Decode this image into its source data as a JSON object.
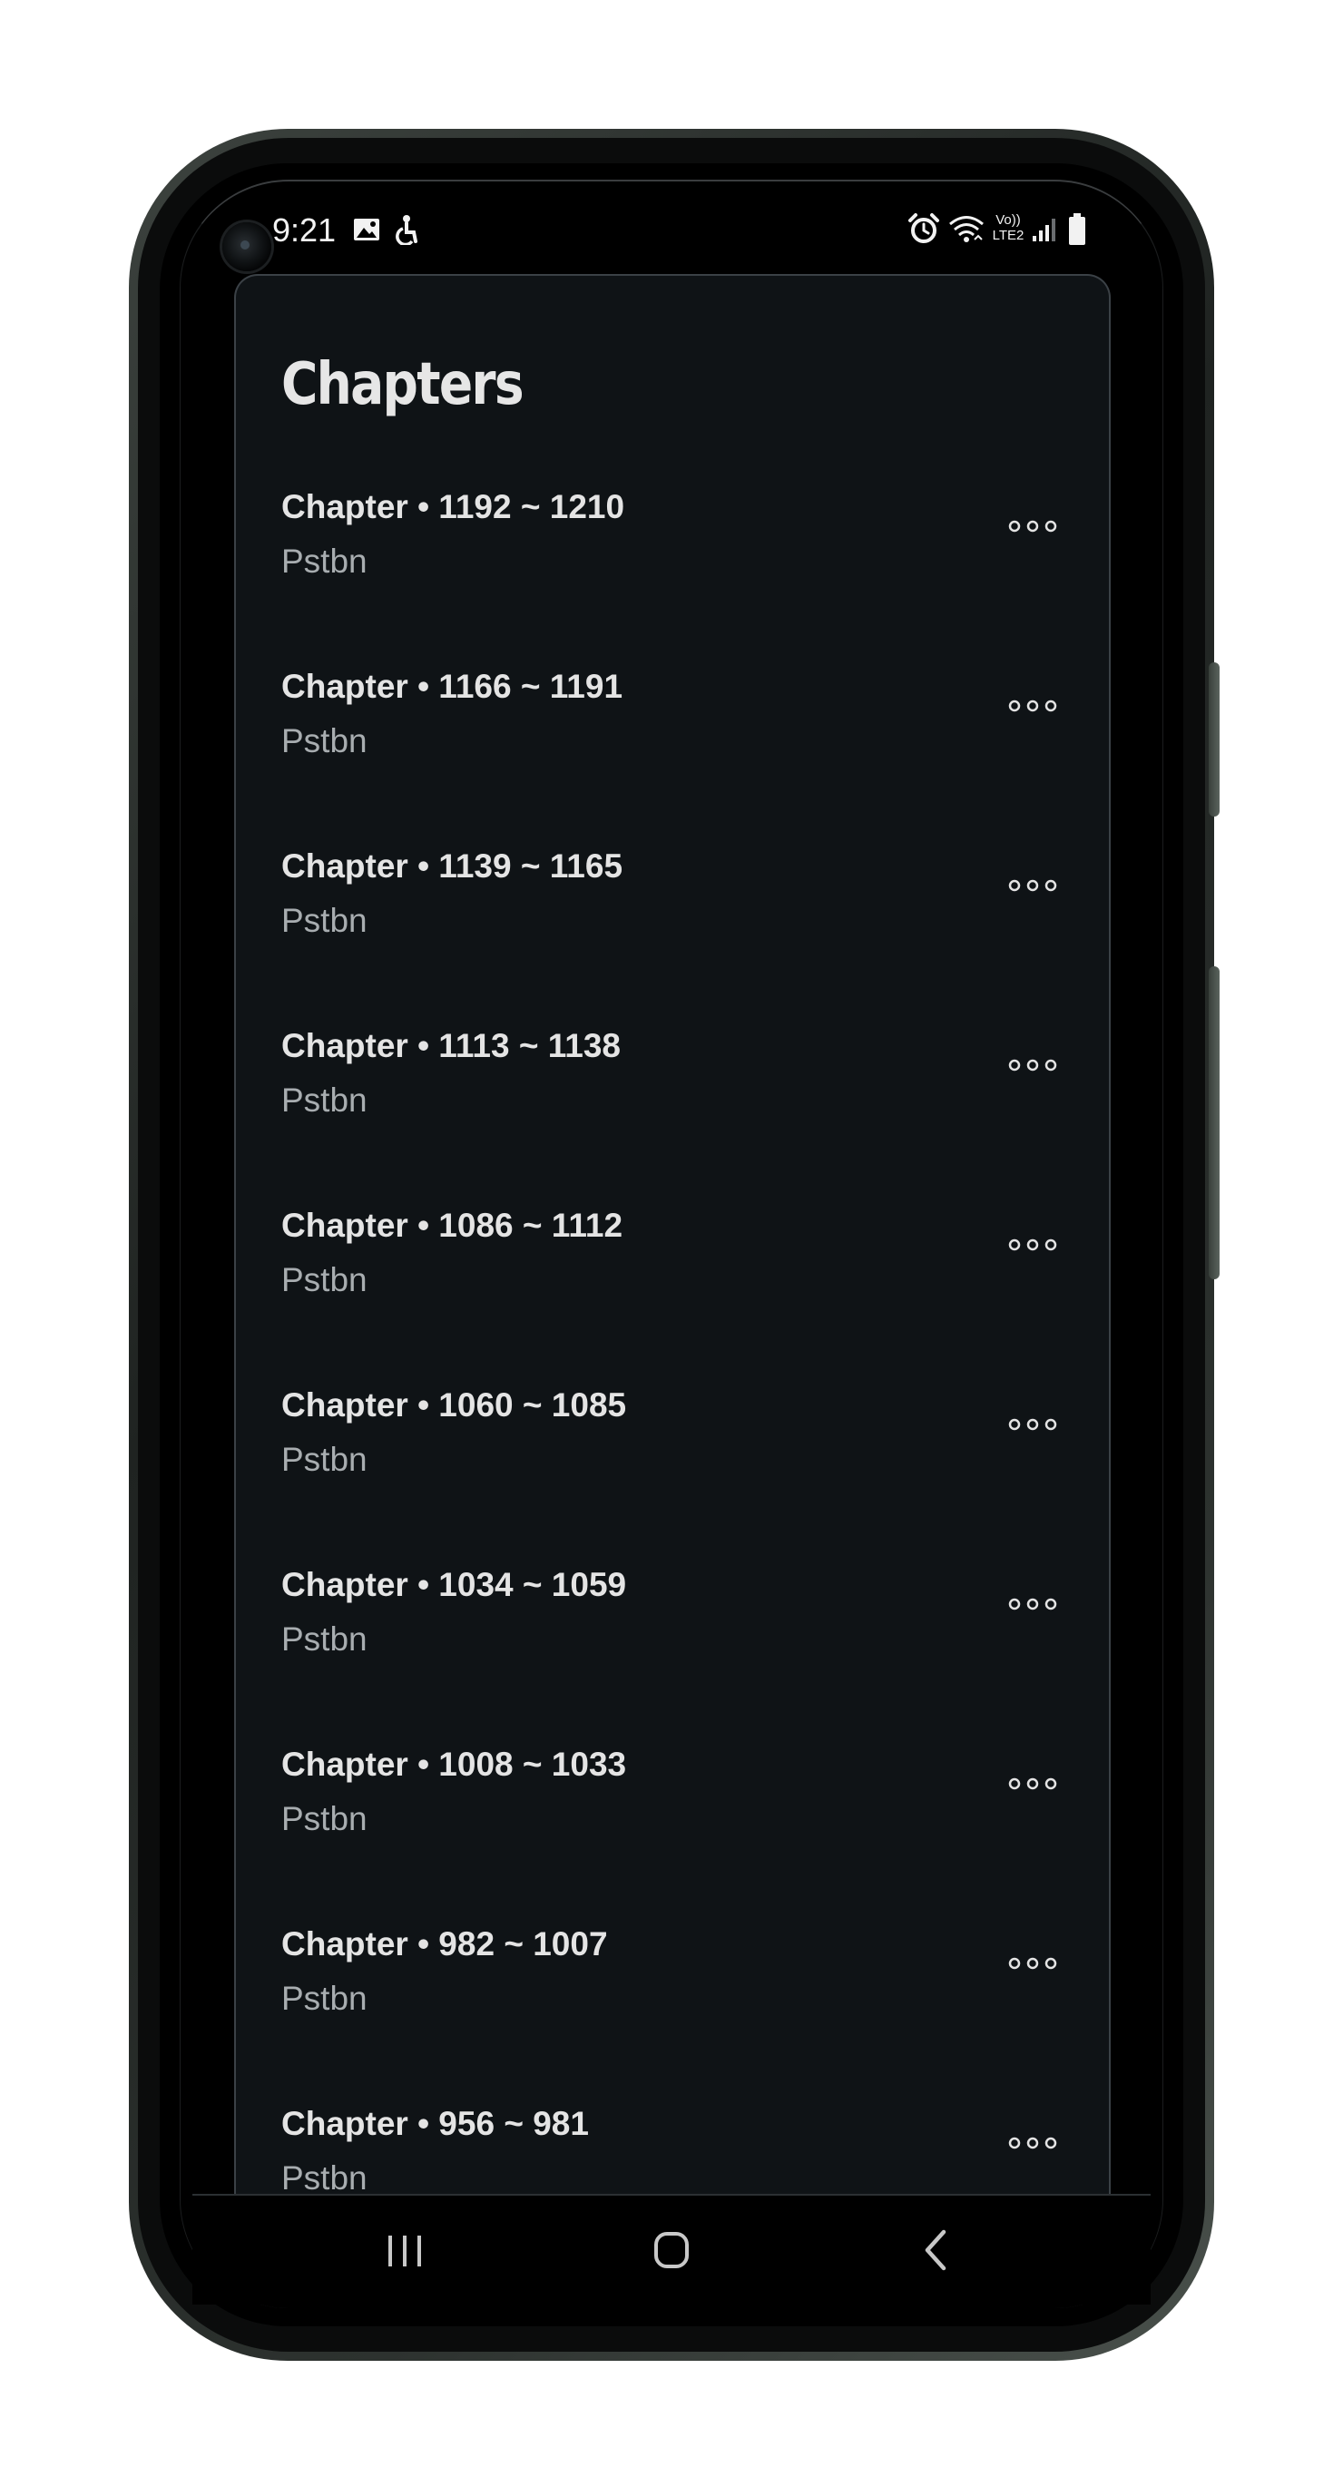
{
  "status_bar": {
    "time": "9:21",
    "left_icons": [
      "image-icon",
      "accessibility-icon"
    ],
    "right_icons": [
      "alarm-icon",
      "wifi-icon",
      "volte-icon",
      "signal-icon",
      "battery-icon"
    ],
    "volte_label_top": "Vo))",
    "volte_label_bottom": "LTE2"
  },
  "page": {
    "title": "Chapters"
  },
  "chapters": [
    {
      "name": "Chapter • 1192 ~ 1210",
      "source": "Pstbn"
    },
    {
      "name": "Chapter • 1166 ~ 1191",
      "source": "Pstbn"
    },
    {
      "name": "Chapter • 1139 ~ 1165",
      "source": "Pstbn"
    },
    {
      "name": "Chapter • 1113 ~ 1138",
      "source": "Pstbn"
    },
    {
      "name": "Chapter • 1086 ~ 1112",
      "source": "Pstbn"
    },
    {
      "name": "Chapter • 1060 ~ 1085",
      "source": "Pstbn"
    },
    {
      "name": "Chapter • 1034 ~ 1059",
      "source": "Pstbn"
    },
    {
      "name": "Chapter • 1008 ~ 1033",
      "source": "Pstbn"
    },
    {
      "name": "Chapter • 982 ~ 1007",
      "source": "Pstbn"
    },
    {
      "name": "Chapter • 956 ~ 981",
      "source": "Pstbn"
    }
  ],
  "row_action_icon": "more-horizontal-icon",
  "nav_bar": {
    "buttons": [
      "recent-apps-icon",
      "home-icon",
      "back-icon"
    ]
  },
  "colors": {
    "card_background": "#0f1316",
    "card_border": "#3b4146",
    "title_text": "#e6e6e6",
    "primary_text": "#e4e4e4",
    "secondary_text": "#a8adb0",
    "screen_background": "#000000"
  }
}
